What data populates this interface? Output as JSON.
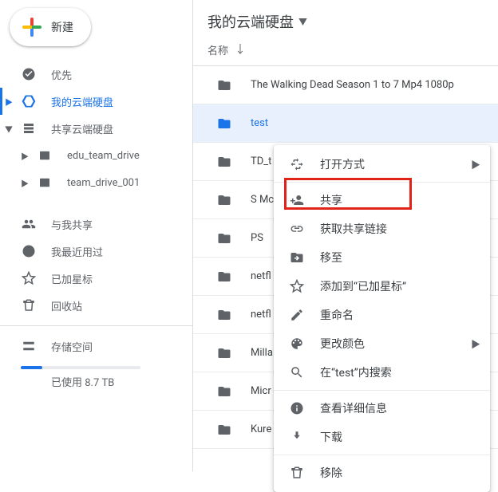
{
  "sidebar": {
    "new_label": "新建",
    "items": [
      {
        "label": "优先"
      },
      {
        "label": "我的云端硬盘"
      },
      {
        "label": "共享云端硬盘"
      },
      {
        "label": "edu_team_drive"
      },
      {
        "label": "team_drive_001"
      },
      {
        "label": "与我共享"
      },
      {
        "label": "我最近用过"
      },
      {
        "label": "已加星标"
      },
      {
        "label": "回收站"
      },
      {
        "label": "存储空间"
      }
    ],
    "storage_used": "已使用 8.7 TB"
  },
  "header": {
    "breadcrumb": "我的云端硬盘",
    "sort_column": "名称"
  },
  "files": [
    {
      "name": "The Walking Dead Season 1 to 7 Mp4 1080p"
    },
    {
      "name": "test"
    },
    {
      "name": "TD_t"
    },
    {
      "name": "S Mc"
    },
    {
      "name": "PS"
    },
    {
      "name": "netfl"
    },
    {
      "name": "netfl"
    },
    {
      "name": "Milla"
    },
    {
      "name": "Micr"
    },
    {
      "name": "Kure"
    }
  ],
  "context_menu": {
    "open_with": "打开方式",
    "share": "共享",
    "get_link": "获取共享链接",
    "move_to": "移至",
    "add_star": "添加到“已加星标”",
    "rename": "重命名",
    "change_color": "更改颜色",
    "search_within": "在“test”内搜索",
    "view_details": "查看详细信息",
    "download": "下载",
    "remove": "移除"
  }
}
